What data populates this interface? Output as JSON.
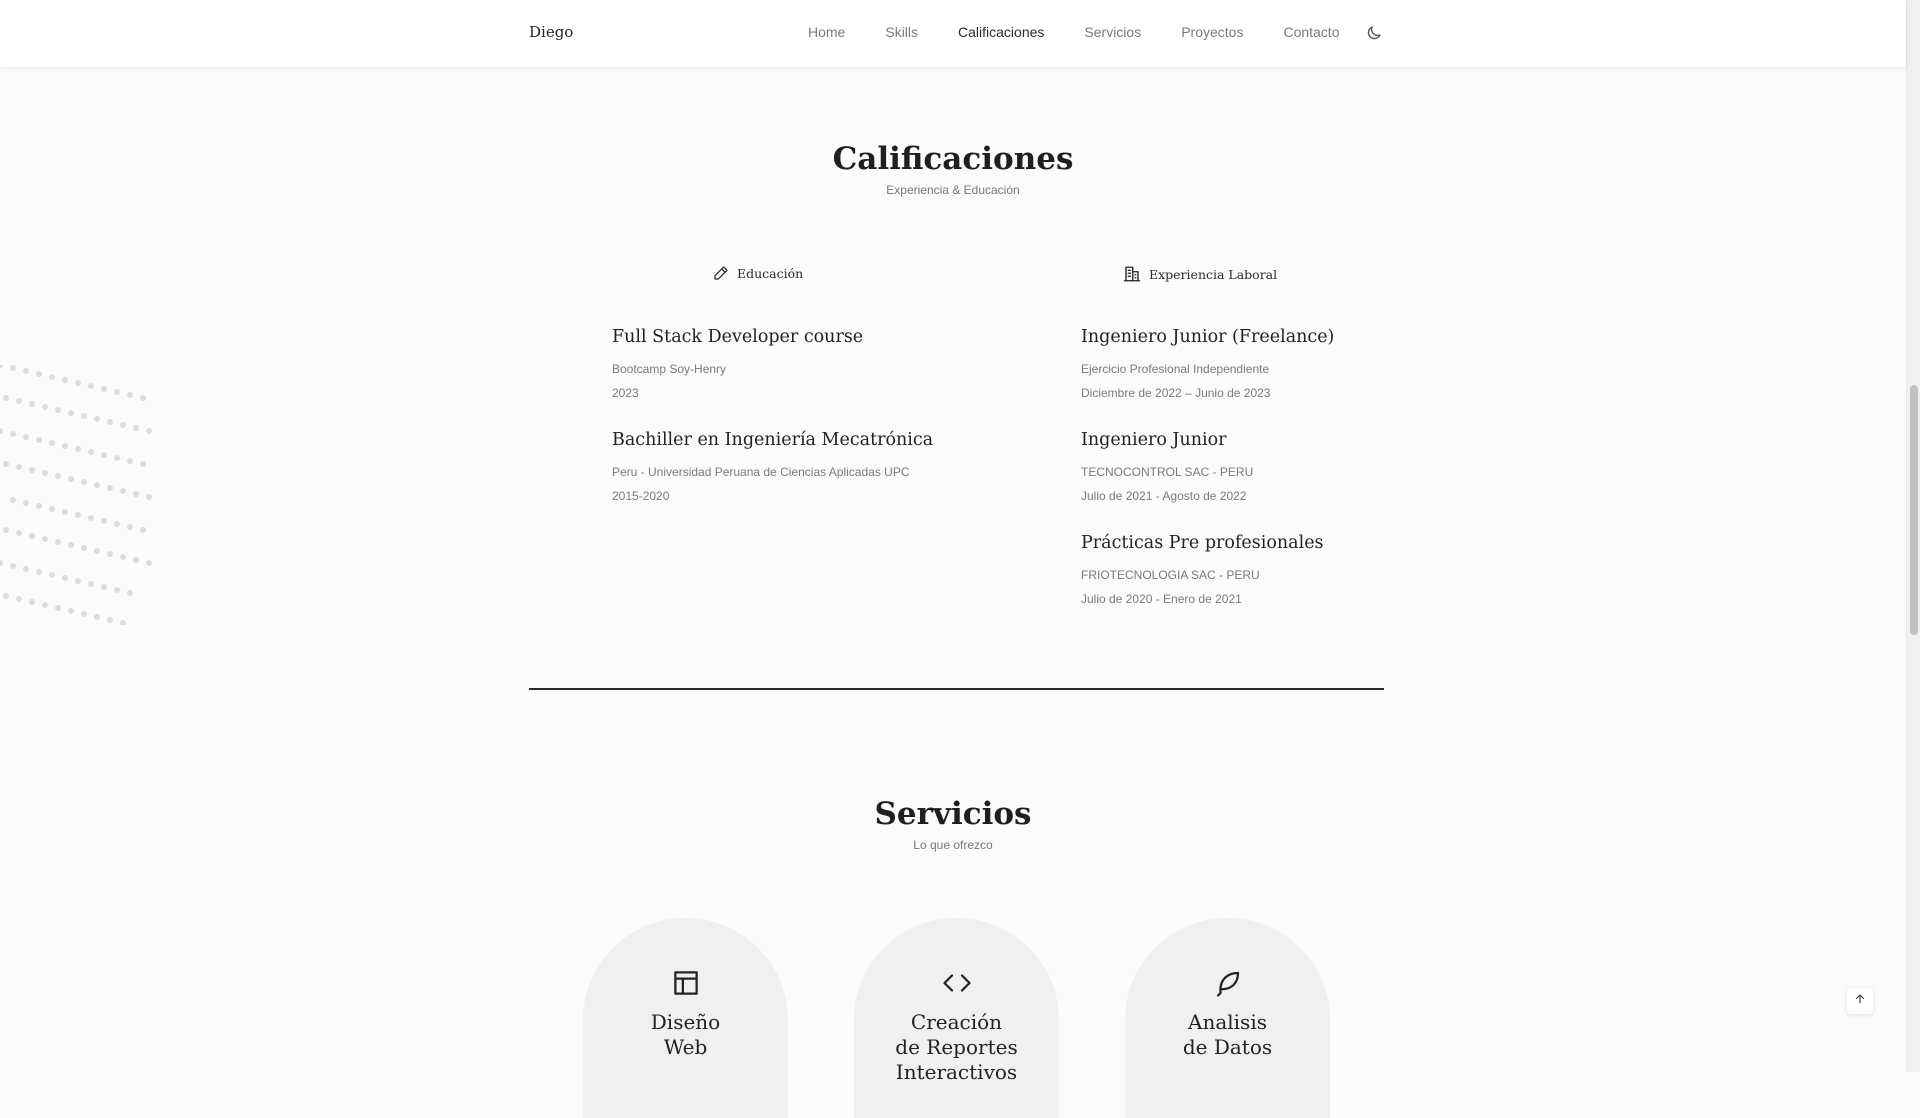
{
  "header": {
    "logo": "Diego",
    "nav": [
      "Home",
      "Skills",
      "Calificaciones",
      "Servicios",
      "Proyectos",
      "Contacto"
    ],
    "active_nav": "Calificaciones",
    "theme_icon": "moon-icon"
  },
  "qualifications": {
    "title": "Calificaciones",
    "subtitle": "Experiencia & Educación",
    "tabs": {
      "education": {
        "label": "Educación",
        "icon": "pencil-icon"
      },
      "work": {
        "label": "Experiencia Laboral",
        "icon": "building-icon"
      }
    },
    "education": [
      {
        "title": "Full Stack Developer course",
        "subtitle": "Bootcamp Soy-Henry",
        "date": "2023"
      },
      {
        "title": "Bachiller en Ingeniería Mecatrónica",
        "subtitle": "Peru - Universidad Peruana de Ciencias Aplicadas UPC",
        "date": "2015-2020"
      }
    ],
    "work": [
      {
        "title": "Ingeniero Junior (Freelance)",
        "subtitle": "Ejercicio Profesional Independiente",
        "date": "Diciembre de 2022 – Junio de 2023"
      },
      {
        "title": "Ingeniero Junior",
        "subtitle": "TECNOCONTROL SAC - PERU",
        "date": "Julio de 2021 - Agosto de 2022"
      },
      {
        "title": "Prácticas Pre profesionales",
        "subtitle": "FRIOTECNOLOGIA SAC - PERU",
        "date": "Julio de 2020 - Enero de 2021"
      }
    ]
  },
  "services": {
    "title": "Servicios",
    "subtitle": "Lo que ofrezco",
    "cards": [
      {
        "line1": "Diseño",
        "line2": "Web",
        "line3": "",
        "icon": "layout-icon"
      },
      {
        "line1": "Creación",
        "line2": "de Reportes",
        "line3": "Interactivos",
        "icon": "code-icon"
      },
      {
        "line1": "Analisis",
        "line2": "de Datos",
        "line3": "",
        "icon": "feather-icon"
      }
    ]
  },
  "scroll_top_icon": "arrow-up-icon"
}
